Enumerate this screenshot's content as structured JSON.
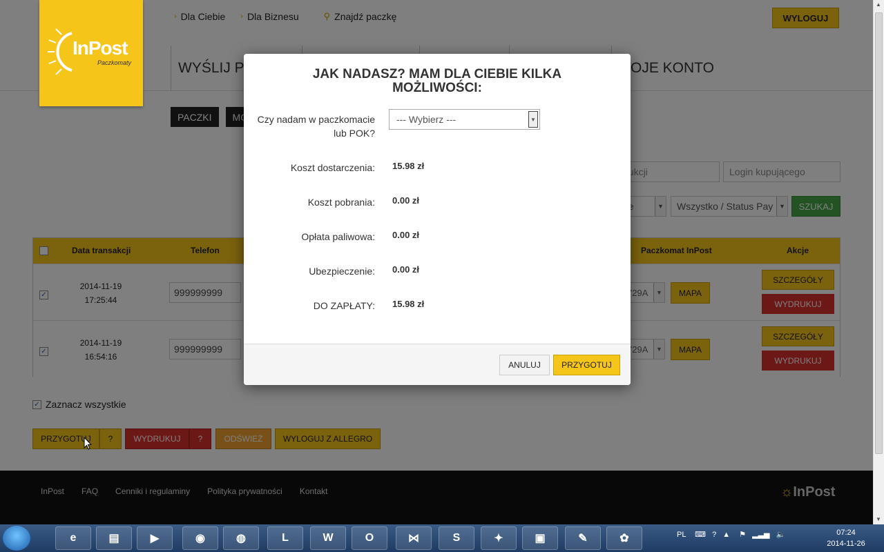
{
  "header": {
    "logo_brand": "InPost",
    "logo_sub": "Paczkomaty",
    "topnav": [
      "Dla Ciebie",
      "Dla Biznesu",
      "Znajdź paczkę"
    ],
    "logout": "WYLOGUJ",
    "mainnav": [
      "WYŚLIJ P",
      "",
      "",
      "",
      "OJE KONTO"
    ]
  },
  "tabs": [
    "PACZKI",
    "MO"
  ],
  "filters": {
    "transaction_placeholder": "aukcji",
    "buyer_placeholder": "Login kupującego",
    "select1": "ne",
    "select2": "Wszystko / Status Pay",
    "search_button": "SZUKAJ"
  },
  "table": {
    "headers": [
      "Data transakcji",
      "Telefon",
      "Paczkomat InPost",
      "Akcje"
    ],
    "rows": [
      {
        "date": "2014-11-19",
        "time": "17:25:44",
        "phone": "999999999",
        "locker": "729A",
        "map": "MAPA",
        "details": "SZCZEGÓŁY",
        "print": "WYDRUKUJ"
      },
      {
        "date": "2014-11-19",
        "time": "16:54:16",
        "phone": "999999999",
        "locker": "729A",
        "map": "MAPA",
        "details": "SZCZEGÓŁY",
        "print": "WYDRUKUJ"
      }
    ]
  },
  "select_all": "Zaznacz wszystkie",
  "actions": {
    "prepare": "PRZYGOTUJ",
    "help": "?",
    "print": "WYDRUKUJ",
    "refresh": "ODŚWIEŻ",
    "logout_allegro": "WYLOGUJ Z ALLEGRO"
  },
  "footer": {
    "links": [
      "InPost",
      "FAQ",
      "Cenniki i regulaminy",
      "Polityka prywatności",
      "Kontakt"
    ],
    "logo": "InPost"
  },
  "modal": {
    "title": "JAK NADASZ? MAM DLA CIEBIE KILKA MOŻLIWOŚCI:",
    "send_question": "Czy nadam w paczkomacie lub POK?",
    "send_select": "--- Wybierz ---",
    "rows": [
      {
        "label": "Koszt dostarczenia:",
        "value": "15.98 zł"
      },
      {
        "label": "Koszt pobrania:",
        "value": "0.00 zł"
      },
      {
        "label": "Opłata paliwowa:",
        "value": "0.00 zł"
      },
      {
        "label": "Ubezpieczenie:",
        "value": "0.00 zł"
      },
      {
        "label": "DO ZAPŁATY:",
        "value": "15.98 zł"
      }
    ],
    "cancel": "ANULUJ",
    "confirm": "PRZYGOTUJ"
  },
  "taskbar": {
    "lang": "PL",
    "time": "07:24",
    "date": "2014-11-26"
  },
  "colors": {
    "brand_yellow": "#f6c51a",
    "danger_red": "#d9302f",
    "success_green": "#46a546",
    "refresh_orange": "#f0a030"
  }
}
